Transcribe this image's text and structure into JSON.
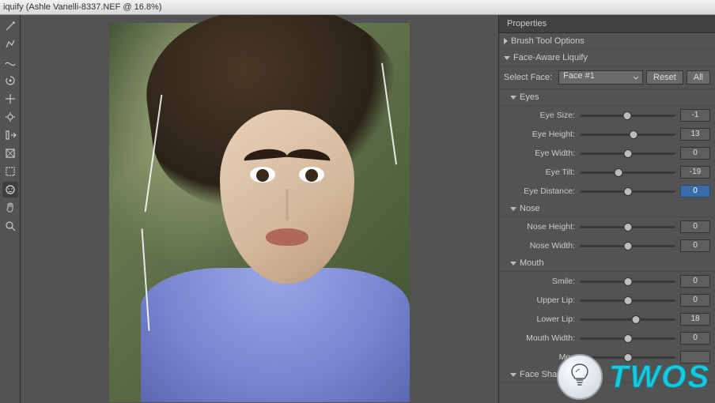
{
  "window": {
    "title": "iquify (Ashle Vanelli-8337.NEF @ 16.8%)"
  },
  "tools": [
    {
      "name": "forward-warp-tool",
      "icon": "warp"
    },
    {
      "name": "reconstruct-tool",
      "icon": "reconstruct"
    },
    {
      "name": "smooth-tool",
      "icon": "smooth"
    },
    {
      "name": "twirl-tool",
      "icon": "twirl"
    },
    {
      "name": "pucker-tool",
      "icon": "pucker"
    },
    {
      "name": "bloat-tool",
      "icon": "bloat"
    },
    {
      "name": "push-left-tool",
      "icon": "push"
    },
    {
      "name": "freeze-mask-tool",
      "icon": "freeze"
    },
    {
      "name": "thaw-mask-tool",
      "icon": "thaw"
    },
    {
      "name": "face-tool",
      "icon": "face",
      "active": true
    },
    {
      "name": "hand-tool",
      "icon": "hand"
    },
    {
      "name": "zoom-tool",
      "icon": "zoom"
    }
  ],
  "panel": {
    "header": "Properties",
    "brush_section": "Brush Tool Options",
    "face_section": "Face-Aware Liquify",
    "select_face_label": "Select Face:",
    "face_dropdown": "Face #1",
    "reset_btn": "Reset",
    "all_btn": "All",
    "groups": {
      "eyes": {
        "label": "Eyes",
        "sliders": [
          {
            "label": "Eye Size:",
            "value": -1
          },
          {
            "label": "Eye Height:",
            "value": 13
          },
          {
            "label": "Eye Width:",
            "value": 0
          },
          {
            "label": "Eye Tilt:",
            "value": -19
          },
          {
            "label": "Eye Distance:",
            "value": 0,
            "active": true
          }
        ]
      },
      "nose": {
        "label": "Nose",
        "sliders": [
          {
            "label": "Nose Height:",
            "value": 0
          },
          {
            "label": "Nose Width:",
            "value": 0
          }
        ]
      },
      "mouth": {
        "label": "Mouth",
        "sliders": [
          {
            "label": "Smile:",
            "value": 0
          },
          {
            "label": "Upper Lip:",
            "value": 0
          },
          {
            "label": "Lower Lip:",
            "value": 18
          },
          {
            "label": "Mouth Width:",
            "value": 0
          },
          {
            "label": "Mou",
            "value": "",
            "cut": true
          }
        ]
      },
      "face_shape": {
        "label": "Face Shape"
      }
    }
  },
  "watermark": {
    "text": "TWOS"
  }
}
